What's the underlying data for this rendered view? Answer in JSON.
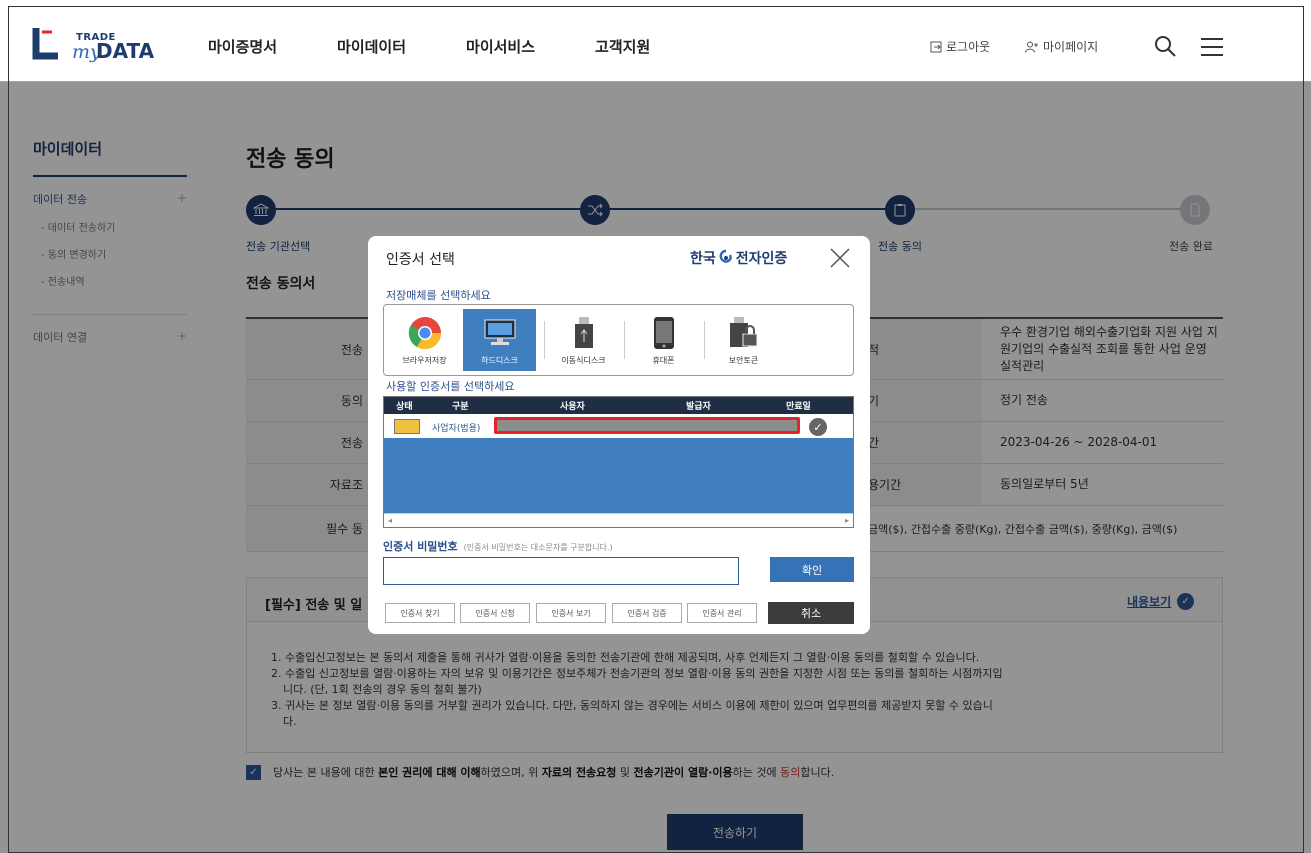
{
  "header": {
    "logo": {
      "top": "TRADE",
      "my": "my",
      "data": "DATA"
    },
    "nav": [
      "마이증명서",
      "마이데이터",
      "마이서비스",
      "고객지원"
    ],
    "logout": "로그아웃",
    "mypage": "마이페이지",
    "accent_color": "#1e3d6f"
  },
  "lnb": {
    "title": "마이데이터",
    "group1": "데이터 전송",
    "sub": [
      "- 데이터 전송하기",
      "- 동의 변경하기",
      "- 전송내역"
    ],
    "group2": "데이터 연결",
    "plus": "+"
  },
  "main": {
    "title": "전송 동의",
    "steps": [
      {
        "label": "전송 기관선택",
        "done": true
      },
      {
        "label": "",
        "done": true
      },
      {
        "label": "전송 동의",
        "done": true
      },
      {
        "label": "전송 완료",
        "done": false
      }
    ],
    "section_title": "전송 동의서",
    "rows": [
      {
        "left": "전송",
        "right_head": "적",
        "right_value": "우수 환경기업 해외수출기업화 지원 사업 지원기업의 수출실적 조회를 통한 사업 운영 실적관리"
      },
      {
        "left": "동의",
        "right_head": "기",
        "right_value": "정기 전송"
      },
      {
        "left": "전송",
        "right_head": "간",
        "right_value": "2023-04-26  ~  2028-04-01"
      },
      {
        "left": "자료조",
        "right_head": "용기간",
        "right_value": "동의일로부터 5년"
      }
    ],
    "wide_row": {
      "left": "필수 동",
      "value": "금액($), 간접수출 중량(Kg), 간접수출 금액($), 중량(Kg), 금액($)"
    },
    "agree": {
      "title": "[필수] 전송 및 일",
      "view": "내용보기",
      "items": [
        "1. 수출입신고정보는 본 동의서 제출을 통해 귀사가 열람·이용을 동의한 전송기관에 한해 제공되며, 사후 언제든지 그 열람·이용 동의를 철회할 수 있습니다.",
        "2. 수출입 신고정보를 열람·이용하는 자의 보유 및 이용기간은 정보주체가 전송기관의 정보 열람·이용 동의 권한을 지정한 시점 또는 동의를 철회하는 시점까지입",
        "니다. (단, 1회 전송의 경우 동의 철회 불가)",
        "3. 귀사는 본 정보 열람·이용 동의를 거부할 권리가 있습니다. 다만, 동의하지 않는 경우에는 서비스 이용에 제한이 있으며 업무편의를 제공받지 못할 수 있습니",
        "다."
      ]
    },
    "consent": {
      "p1": "당사는 본 내용에 대한 ",
      "b1": "본인 권리에 대해 이해",
      "p2": "하였으며, 위 ",
      "b2": "자료의 전송요청",
      "p3": " 및 ",
      "b3": "전송기관이 열람·이용",
      "p4": "하는 것에 ",
      "red": "동의",
      "p5": "합니다."
    },
    "send_button": "전송하기"
  },
  "modal": {
    "title": "인증서 선택",
    "brand_left": "한국",
    "brand_right": "전자인증",
    "storage_label": "저장매체를 선택하세요",
    "media": [
      {
        "name": "browser-icon",
        "label": "브라우저저장",
        "selected": false
      },
      {
        "name": "harddisk-icon",
        "label": "하드디스크",
        "selected": true
      },
      {
        "name": "usb-icon",
        "label": "이동식디스크",
        "selected": false
      },
      {
        "name": "phone-icon",
        "label": "휴대폰",
        "selected": false
      },
      {
        "name": "security-token-icon",
        "label": "보안토큰",
        "selected": false
      }
    ],
    "cert_label": "사용할 인증서를 선택하세요",
    "columns": [
      "상태",
      "구분",
      "사용자",
      "발급자",
      "만료일"
    ],
    "cert_row": {
      "kind": "사업자(법용)"
    },
    "pw_label": "인증서 비밀번호",
    "pw_hint": "(인증서 비밀번호는 대소문자를 구분합니다.)",
    "ok": "확인",
    "buttons": [
      "인증서 찾기",
      "인증서 신청",
      "인증서 보기",
      "인증서 검증",
      "인증서 관리"
    ],
    "cancel": "취소",
    "scroll_left": "◂",
    "scroll_right": "▸"
  }
}
